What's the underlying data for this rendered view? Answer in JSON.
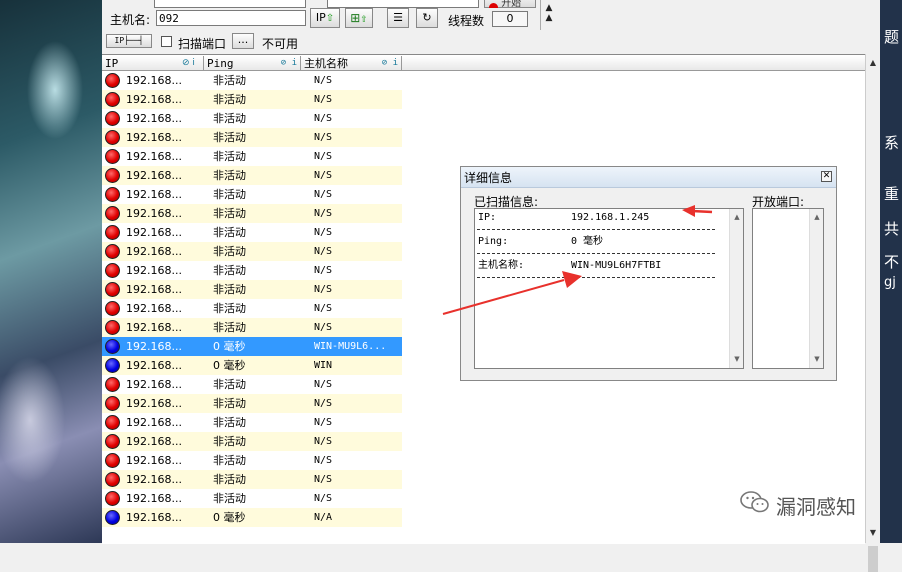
{
  "toolbar": {
    "hostname_label": "主机名:",
    "hostname_value": "092",
    "ip_button": "IP",
    "scan_ports_label": "扫描端口",
    "ports_button": "...",
    "unavailable_label": "不可用",
    "threads_label": "线程数",
    "threads_value": "0",
    "start_label": "开始"
  },
  "columns": [
    "IP",
    "Ping",
    "主机名称"
  ],
  "rows": [
    {
      "status": "red",
      "ip": "192.168...",
      "ping": "非活动",
      "host": "N/S"
    },
    {
      "status": "red",
      "ip": "192.168...",
      "ping": "非活动",
      "host": "N/S"
    },
    {
      "status": "red",
      "ip": "192.168...",
      "ping": "非活动",
      "host": "N/S"
    },
    {
      "status": "red",
      "ip": "192.168...",
      "ping": "非活动",
      "host": "N/S"
    },
    {
      "status": "red",
      "ip": "192.168...",
      "ping": "非活动",
      "host": "N/S"
    },
    {
      "status": "red",
      "ip": "192.168...",
      "ping": "非活动",
      "host": "N/S"
    },
    {
      "status": "red",
      "ip": "192.168...",
      "ping": "非活动",
      "host": "N/S"
    },
    {
      "status": "red",
      "ip": "192.168...",
      "ping": "非活动",
      "host": "N/S"
    },
    {
      "status": "red",
      "ip": "192.168...",
      "ping": "非活动",
      "host": "N/S"
    },
    {
      "status": "red",
      "ip": "192.168...",
      "ping": "非活动",
      "host": "N/S"
    },
    {
      "status": "red",
      "ip": "192.168...",
      "ping": "非活动",
      "host": "N/S"
    },
    {
      "status": "red",
      "ip": "192.168...",
      "ping": "非活动",
      "host": "N/S"
    },
    {
      "status": "red",
      "ip": "192.168...",
      "ping": "非活动",
      "host": "N/S"
    },
    {
      "status": "red",
      "ip": "192.168...",
      "ping": "非活动",
      "host": "N/S"
    },
    {
      "status": "blue",
      "ip": "192.168...",
      "ping": "0 毫秒",
      "host": "WIN-MU9L6...",
      "selected": true
    },
    {
      "status": "blue",
      "ip": "192.168...",
      "ping": "0 毫秒",
      "host": "WIN"
    },
    {
      "status": "red",
      "ip": "192.168...",
      "ping": "非活动",
      "host": "N/S"
    },
    {
      "status": "red",
      "ip": "192.168...",
      "ping": "非活动",
      "host": "N/S"
    },
    {
      "status": "red",
      "ip": "192.168...",
      "ping": "非活动",
      "host": "N/S"
    },
    {
      "status": "red",
      "ip": "192.168...",
      "ping": "非活动",
      "host": "N/S"
    },
    {
      "status": "red",
      "ip": "192.168...",
      "ping": "非活动",
      "host": "N/S"
    },
    {
      "status": "red",
      "ip": "192.168...",
      "ping": "非活动",
      "host": "N/S"
    },
    {
      "status": "red",
      "ip": "192.168...",
      "ping": "非活动",
      "host": "N/S"
    },
    {
      "status": "blue",
      "ip": "192.168...",
      "ping": "0 毫秒",
      "host": "N/A"
    }
  ],
  "dialog": {
    "title": "详细信息",
    "scanned_label": "已扫描信息:",
    "ports_label": "开放端口:",
    "info": [
      {
        "key": "IP:",
        "value": "192.168.1.245"
      },
      {
        "key": "Ping:",
        "value": "0 毫秒"
      },
      {
        "key": "主机名称:",
        "value": "WIN-MU9L6H7FTBI"
      }
    ]
  },
  "watermark": "漏洞感知",
  "side_glyphs": [
    "题",
    "系",
    "重",
    "共",
    "不",
    "gj"
  ],
  "colors": {
    "selected_row": "#3399ff",
    "alt_row": "#fffbdc",
    "arrow": "#e8312c",
    "active": "#0000e0",
    "inactive": "#e00000"
  }
}
